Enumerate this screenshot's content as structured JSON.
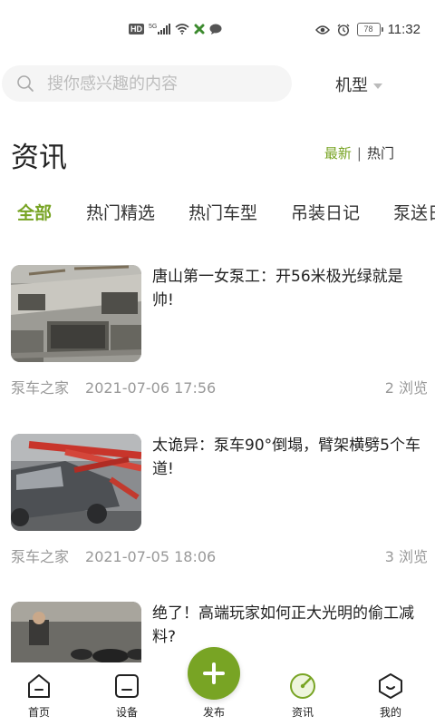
{
  "status_bar": {
    "hd": "HD",
    "network": "5G",
    "battery": "78",
    "time": "11:32"
  },
  "search": {
    "placeholder": "搜你感兴趣的内容"
  },
  "model_filter": {
    "label": "机型"
  },
  "header": {
    "title": "资讯",
    "sort_latest": "最新",
    "sort_divider": "|",
    "sort_hot": "热门"
  },
  "tabs": [
    {
      "label": "全部",
      "active": true
    },
    {
      "label": "热门精选"
    },
    {
      "label": "热门车型"
    },
    {
      "label": "吊装日记"
    },
    {
      "label": "泵送日"
    }
  ],
  "articles": [
    {
      "title": "唐山第一女泵工：开56米极光绿就是帅!",
      "source": "泵车之家",
      "date": "2021-07-06 17:56",
      "views": "2 浏览"
    },
    {
      "title": "太诡异：泵车90°倒塌，臂架横劈5个车道!",
      "source": "泵车之家",
      "date": "2021-07-05 18:06",
      "views": "3 浏览"
    },
    {
      "title": "绝了！高端玩家如何正大光明的偷工减料?",
      "source": "",
      "date": "",
      "views": ""
    }
  ],
  "bottom_nav": {
    "home": "首页",
    "device": "设备",
    "publish": "发布",
    "news": "资讯",
    "mine": "我的"
  },
  "colors": {
    "accent": "#78a424",
    "muted": "#999999"
  }
}
